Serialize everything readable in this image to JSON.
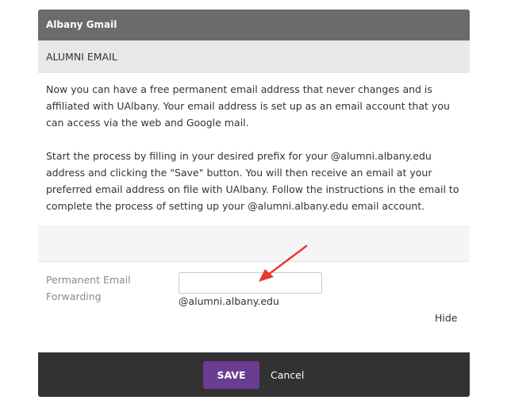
{
  "panel": {
    "title": "Albany Gmail",
    "section_header": "ALUMNI EMAIL",
    "intro_paragraph_1": "Now you can have a free permanent email address that never changes and is affiliated with UAlbany. Your email address is set up as an email account that you can access via the web and Google mail.",
    "intro_paragraph_2": "Start the process by filling in your desired prefix for your @alumni.albany.edu address and clicking the \"Save\" button. You will then receive an email at your preferred email address on file with UAlbany. Follow the instructions in the email to complete the process of setting up your @alumni.albany.edu email account."
  },
  "form": {
    "field_label": "Permanent Email Forwarding",
    "input_value": "",
    "input_placeholder": "",
    "domain_suffix": "@alumni.albany.edu",
    "hide_label": "Hide"
  },
  "footer": {
    "save_label": "SAVE",
    "cancel_label": "Cancel"
  },
  "colors": {
    "titlebar": "#6b6b6b",
    "section_header": "#e8e8e8",
    "footer": "#323232",
    "save_button": "#6a3d91",
    "annotation_arrow": "#e8382f"
  }
}
